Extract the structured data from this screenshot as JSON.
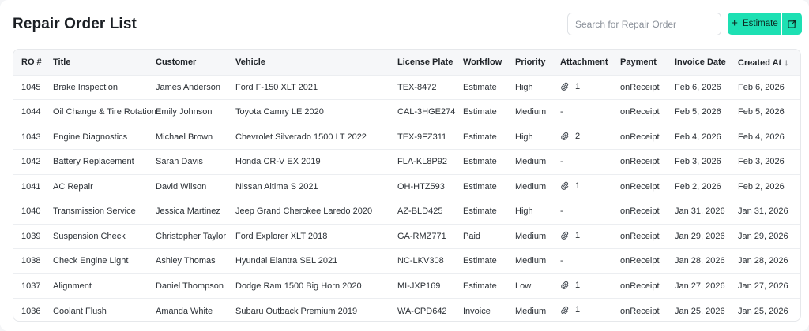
{
  "header": {
    "title": "Repair Order List",
    "search_placeholder": "Search for Repair Order",
    "estimate_label": "Estimate",
    "estimate_icon": "plus-icon",
    "external_icon": "external-link-icon",
    "accent_color": "#1de0b3"
  },
  "table": {
    "columns": [
      "RO #",
      "Title",
      "Customer",
      "Vehicle",
      "License Plate",
      "Workflow",
      "Priority",
      "Attachment",
      "Payment",
      "Invoice Date",
      "Created At"
    ],
    "sort_indicator": "↓",
    "rows": [
      {
        "ro": "1045",
        "title": "Brake Inspection",
        "customer": "James Anderson",
        "vehicle": "Ford F-150 XLT 2021",
        "plate": "TEX-8472",
        "workflow": "Estimate",
        "priority": "High",
        "attachment": "1",
        "payment": "onReceipt",
        "invoice_date": "Feb 6, 2026",
        "created_at": "Feb 6, 2026"
      },
      {
        "ro": "1044",
        "title": "Oil Change & Tire Rotation",
        "customer": "Emily Johnson",
        "vehicle": "Toyota Camry LE 2020",
        "plate": "CAL-3HGE274",
        "workflow": "Estimate",
        "priority": "Medium",
        "attachment": "-",
        "payment": "onReceipt",
        "invoice_date": "Feb 5, 2026",
        "created_at": "Feb 5, 2026"
      },
      {
        "ro": "1043",
        "title": "Engine Diagnostics",
        "customer": "Michael Brown",
        "vehicle": "Chevrolet Silverado 1500 LT 2022",
        "plate": "TEX-9FZ311",
        "workflow": "Estimate",
        "priority": "High",
        "attachment": "2",
        "payment": "onReceipt",
        "invoice_date": "Feb 4, 2026",
        "created_at": "Feb 4, 2026"
      },
      {
        "ro": "1042",
        "title": "Battery Replacement",
        "customer": "Sarah Davis",
        "vehicle": "Honda CR-V EX 2019",
        "plate": "FLA-KL8P92",
        "workflow": "Estimate",
        "priority": "Medium",
        "attachment": "-",
        "payment": "onReceipt",
        "invoice_date": "Feb 3, 2026",
        "created_at": "Feb 3, 2026"
      },
      {
        "ro": "1041",
        "title": "AC Repair",
        "customer": "David Wilson",
        "vehicle": "Nissan Altima S 2021",
        "plate": "OH-HTZ593",
        "workflow": "Estimate",
        "priority": "Medium",
        "attachment": "1",
        "payment": "onReceipt",
        "invoice_date": "Feb 2, 2026",
        "created_at": "Feb 2, 2026"
      },
      {
        "ro": "1040",
        "title": "Transmission Service",
        "customer": "Jessica Martinez",
        "vehicle": "Jeep Grand Cherokee Laredo 2020",
        "plate": "AZ-BLD425",
        "workflow": "Estimate",
        "priority": "High",
        "attachment": "-",
        "payment": "onReceipt",
        "invoice_date": "Jan 31, 2026",
        "created_at": "Jan 31, 2026"
      },
      {
        "ro": "1039",
        "title": "Suspension Check",
        "customer": "Christopher Taylor",
        "vehicle": "Ford Explorer XLT 2018",
        "plate": "GA-RMZ771",
        "workflow": "Paid",
        "priority": "Medium",
        "attachment": "1",
        "payment": "onReceipt",
        "invoice_date": "Jan 29, 2026",
        "created_at": "Jan 29, 2026"
      },
      {
        "ro": "1038",
        "title": "Check Engine Light",
        "customer": "Ashley Thomas",
        "vehicle": "Hyundai Elantra SEL 2021",
        "plate": "NC-LKV308",
        "workflow": "Estimate",
        "priority": "Medium",
        "attachment": "-",
        "payment": "onReceipt",
        "invoice_date": "Jan 28, 2026",
        "created_at": "Jan 28, 2026"
      },
      {
        "ro": "1037",
        "title": "Alignment",
        "customer": "Daniel Thompson",
        "vehicle": "Dodge Ram 1500 Big Horn 2020",
        "plate": "MI-JXP169",
        "workflow": "Estimate",
        "priority": "Low",
        "attachment": "1",
        "payment": "onReceipt",
        "invoice_date": "Jan 27, 2026",
        "created_at": "Jan 27, 2026"
      },
      {
        "ro": "1036",
        "title": "Coolant Flush",
        "customer": "Amanda White",
        "vehicle": "Subaru Outback Premium 2019",
        "plate": "WA-CPD642",
        "workflow": "Invoice",
        "priority": "Medium",
        "attachment": "1",
        "payment": "onReceipt",
        "invoice_date": "Jan 25, 2026",
        "created_at": "Jan 25, 2026"
      }
    ]
  }
}
